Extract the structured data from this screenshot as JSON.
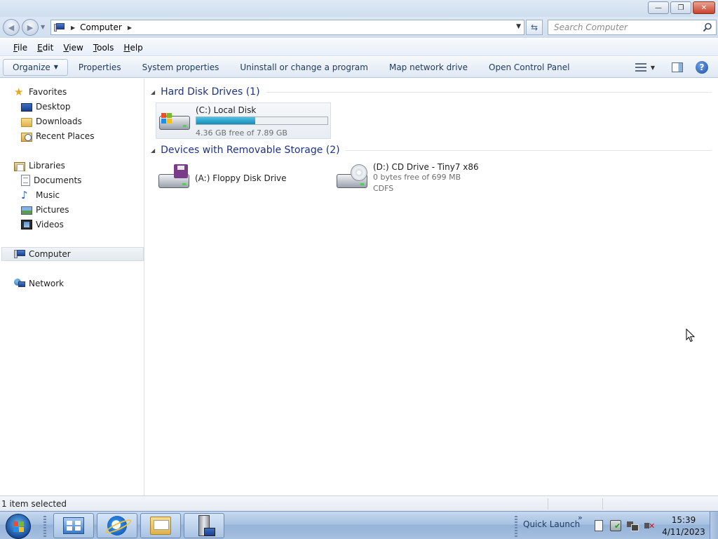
{
  "window": {
    "controls": {
      "minimize": "—",
      "maximize": "❐",
      "close": "✕"
    }
  },
  "address_bar": {
    "back_icon": "back-arrow-icon",
    "forward_icon": "forward-arrow-icon",
    "breadcrumb": [
      "Computer"
    ],
    "search_placeholder": "Search Computer"
  },
  "menu": {
    "items": [
      {
        "label": "File",
        "accel": "F",
        "rest": "ile"
      },
      {
        "label": "Edit",
        "accel": "E",
        "rest": "dit"
      },
      {
        "label": "View",
        "accel": "V",
        "rest": "iew"
      },
      {
        "label": "Tools",
        "accel": "T",
        "rest": "ools"
      },
      {
        "label": "Help",
        "accel": "H",
        "rest": "elp"
      }
    ]
  },
  "commands": {
    "organize": "Organize",
    "items": [
      "Properties",
      "System properties",
      "Uninstall or change a program",
      "Map network drive",
      "Open Control Panel"
    ]
  },
  "nav": {
    "favorites": {
      "label": "Favorites",
      "items": [
        "Desktop",
        "Downloads",
        "Recent Places"
      ]
    },
    "libraries": {
      "label": "Libraries",
      "items": [
        "Documents",
        "Music",
        "Pictures",
        "Videos"
      ]
    },
    "computer": "Computer",
    "network": "Network"
  },
  "groups": {
    "hdd": {
      "header": "Hard Disk Drives (1)",
      "drives": [
        {
          "name": "(C:) Local Disk",
          "free_text": "4.36 GB free of 7.89 GB",
          "used_fraction": 0.447,
          "selected": true
        }
      ]
    },
    "removable": {
      "header": "Devices with Removable Storage (2)",
      "drives": [
        {
          "name": "(A:) Floppy Disk Drive"
        },
        {
          "name": "(D:) CD Drive - Tiny7 x86",
          "free_text": "0 bytes free of 699 MB",
          "fs": "CDFS"
        }
      ]
    }
  },
  "status": {
    "text": "1 item selected"
  },
  "taskbar": {
    "quick_launch": "Quick Launch",
    "quick_launch_chevron": "»",
    "time": "15:39",
    "date": "4/11/2023"
  },
  "colors": {
    "group_header": "#1e3287",
    "capacity_fill": "#26a0cf",
    "command_text": "#1e395b"
  }
}
